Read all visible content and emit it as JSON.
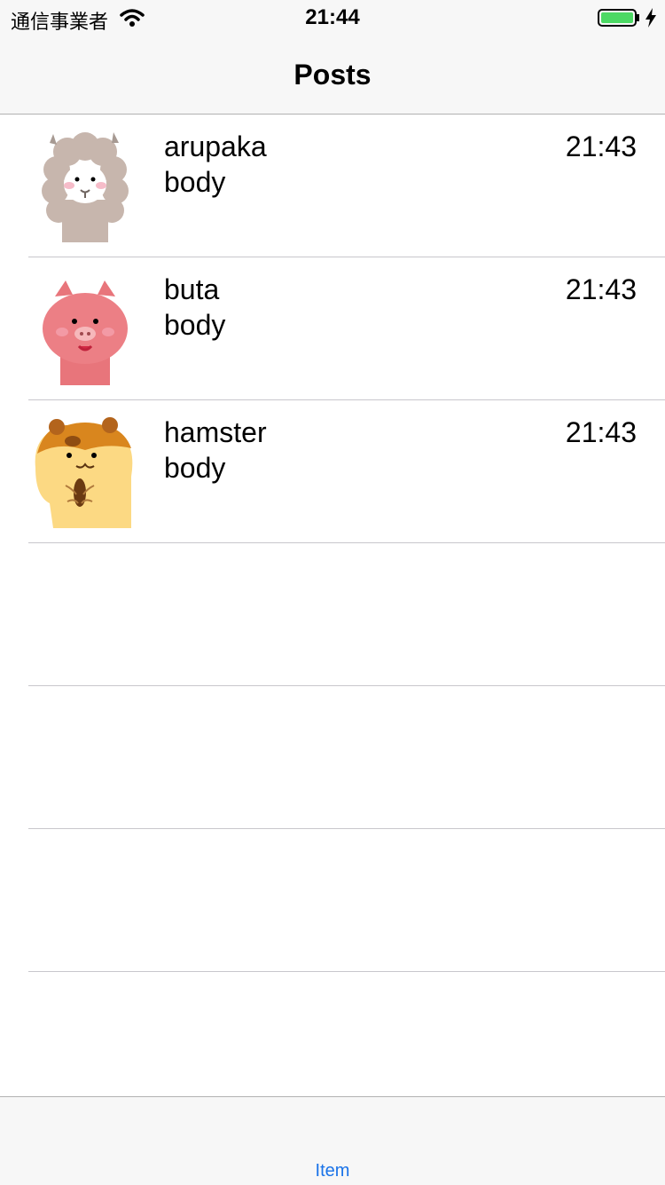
{
  "status": {
    "carrier": "通信事業者",
    "time": "21:44",
    "battery_color": "#4cd964"
  },
  "nav": {
    "title": "Posts"
  },
  "posts": [
    {
      "name": "arupaka",
      "body": "body",
      "time": "21:43",
      "avatar_icon": "alpaca-icon"
    },
    {
      "name": "buta",
      "body": "body",
      "time": "21:43",
      "avatar_icon": "pig-icon"
    },
    {
      "name": "hamster",
      "body": "body",
      "time": "21:43",
      "avatar_icon": "hamster-icon"
    }
  ],
  "tabbar": {
    "item_label": "Item",
    "accent": "#1a73e8"
  }
}
